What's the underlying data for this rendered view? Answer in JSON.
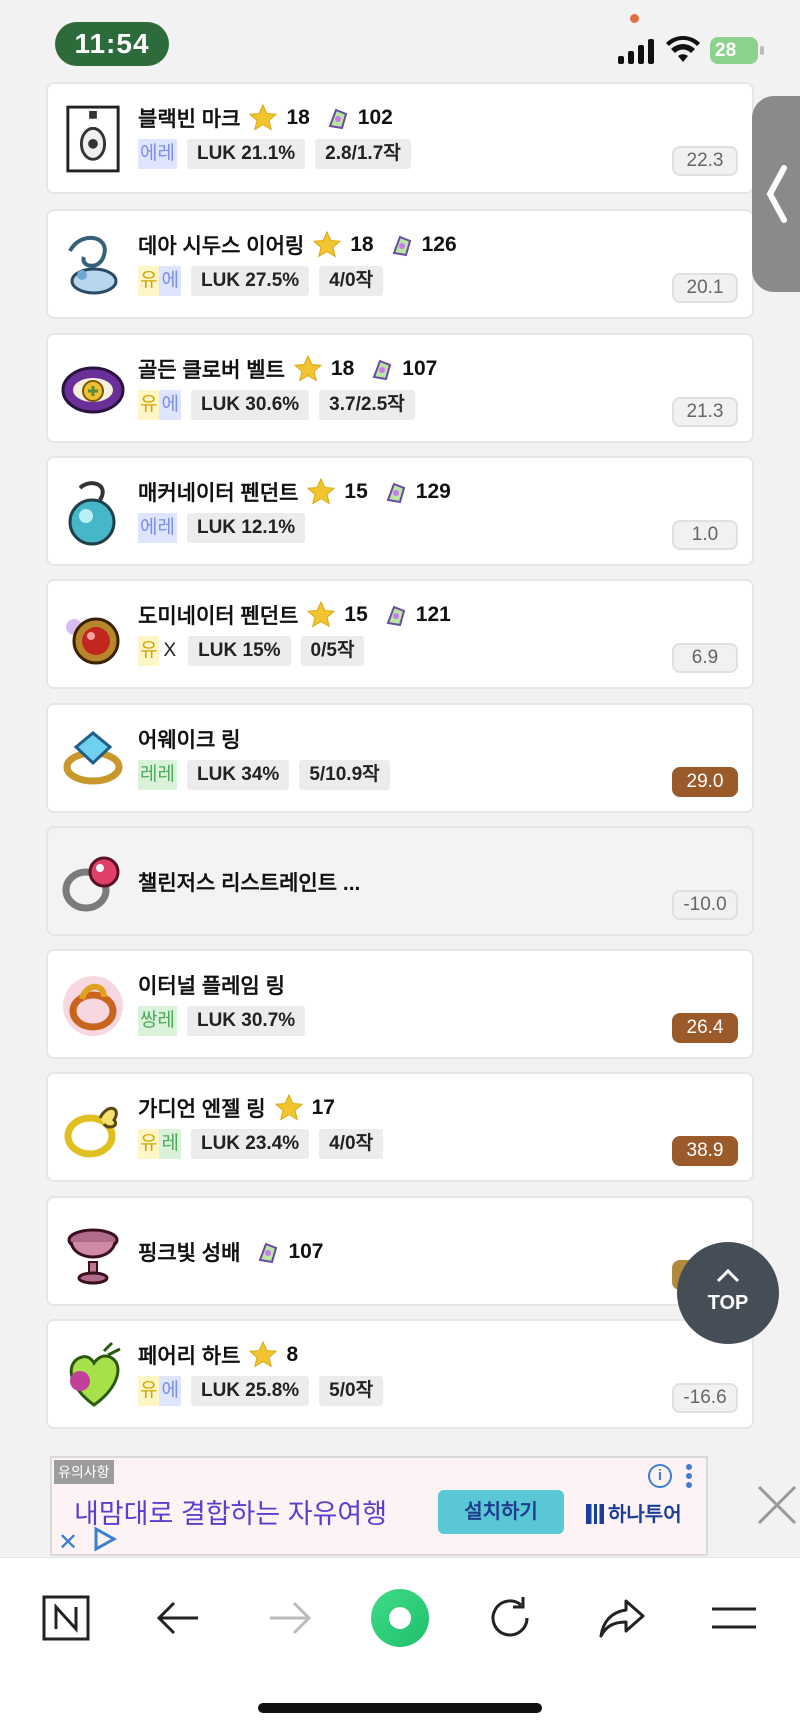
{
  "status": {
    "time": "11:54",
    "battery": "28"
  },
  "items": [
    {
      "name": "블랙빈 마크",
      "star": "18",
      "pot": "102",
      "grade": [
        {
          "t": "에레",
          "c": "b"
        }
      ],
      "stats": [
        "LUK 21.1%",
        "2.8/1.7작"
      ],
      "score": "22.3",
      "score_style": "plain",
      "icon": "mark-icon"
    },
    {
      "name": "데아 시두스 이어링",
      "star": "18",
      "pot": "126",
      "grade": [
        {
          "t": "유",
          "c": "y"
        },
        {
          "t": "에",
          "c": "b"
        }
      ],
      "stats": [
        "LUK 27.5%",
        "4/0작"
      ],
      "score": "20.1",
      "score_style": "plain",
      "icon": "earring-icon"
    },
    {
      "name": "골든 클로버 벨트",
      "star": "18",
      "pot": "107",
      "grade": [
        {
          "t": "유",
          "c": "y"
        },
        {
          "t": "에",
          "c": "b"
        }
      ],
      "stats": [
        "LUK 30.6%",
        "3.7/2.5작"
      ],
      "score": "21.3",
      "score_style": "plain",
      "icon": "belt-icon"
    },
    {
      "name": "매커네이터 펜던트",
      "star": "15",
      "pot": "129",
      "grade": [
        {
          "t": "에레",
          "c": "b"
        }
      ],
      "stats": [
        "LUK 12.1%"
      ],
      "score": "1.0",
      "score_style": "plain",
      "icon": "pendant-blue-icon"
    },
    {
      "name": "도미네이터 펜던트",
      "star": "15",
      "pot": "121",
      "grade": [
        {
          "t": "유",
          "c": "y"
        },
        {
          "t": "X",
          "c": "x"
        }
      ],
      "stats": [
        "LUK 15%",
        "0/5작"
      ],
      "score": "6.9",
      "score_style": "plain",
      "icon": "pendant-red-icon"
    },
    {
      "name": "어웨이크 링",
      "star": "",
      "pot": "",
      "grade": [
        {
          "t": "레레",
          "c": "g"
        }
      ],
      "stats": [
        "LUK 34%",
        "5/10.9작"
      ],
      "score": "29.0",
      "score_style": "hi",
      "icon": "ring-blue-icon"
    },
    {
      "name": "챌린저스 리스트레인트 ...",
      "star": "",
      "pot": "",
      "grade": [],
      "stats": [],
      "score": "-10.0",
      "score_style": "plain",
      "icon": "ring-silver-icon",
      "dim": true
    },
    {
      "name": "이터널 플레임 링",
      "star": "",
      "pot": "",
      "grade": [
        {
          "t": "쌍레",
          "c": "g"
        }
      ],
      "stats": [
        "LUK 30.7%"
      ],
      "score": "26.4",
      "score_style": "hi",
      "icon": "ring-flame-icon"
    },
    {
      "name": "가디언 엔젤 링",
      "star": "17",
      "pot": "",
      "grade": [
        {
          "t": "유",
          "c": "y"
        },
        {
          "t": "레",
          "c": "g"
        }
      ],
      "stats": [
        "LUK 23.4%",
        "4/0작"
      ],
      "score": "38.9",
      "score_style": "hi",
      "icon": "ring-angel-icon"
    },
    {
      "name": "핑크빛 성배",
      "star": "",
      "pot": "107",
      "grade": [],
      "stats": [],
      "score": "76.0",
      "score_style": "gold",
      "icon": "chalice-icon"
    },
    {
      "name": "페어리 하트",
      "star": "8",
      "pot": "",
      "grade": [
        {
          "t": "유",
          "c": "y"
        },
        {
          "t": "에",
          "c": "b"
        }
      ],
      "stats": [
        "LUK 25.8%",
        "5/0작"
      ],
      "score": "-16.6",
      "score_style": "plain",
      "icon": "heart-icon"
    }
  ],
  "top_button": {
    "label": "TOP"
  },
  "ad": {
    "badge": "유의사항",
    "headline": "내맘대로 결합하는 자유여행",
    "cta": "설치하기",
    "brand": "하나투어",
    "info": "i"
  }
}
